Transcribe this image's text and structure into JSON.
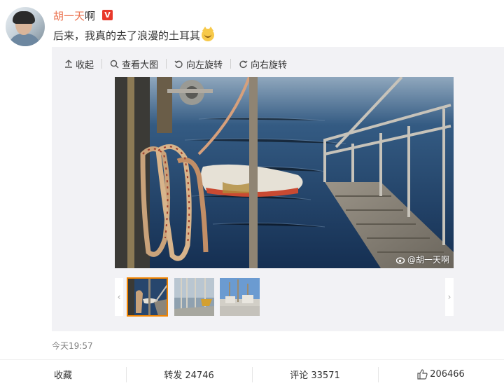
{
  "post": {
    "author_red": "胡一天",
    "author_tail": "啊",
    "verified_mark": "V",
    "text": "后来，我真的去了浪漫的土耳其",
    "emoji": "cat-face-emoji",
    "time": "今天19:57"
  },
  "toolbar": {
    "collapse": "收起",
    "view_large": "查看大图",
    "rotate_left": "向左旋转",
    "rotate_right": "向右旋转"
  },
  "image": {
    "watermark": "@胡一天啊"
  },
  "thumbnails": {
    "count": 3,
    "selected_index": 0
  },
  "actions": {
    "favorite": "收藏",
    "repost": "转发 24746",
    "comment": "评论 33571",
    "like": "206466"
  },
  "colors": {
    "author": "#eb7350",
    "verified": "#e8382b",
    "thumb_selected": "#f08300",
    "media_bg": "#f2f2f5"
  }
}
